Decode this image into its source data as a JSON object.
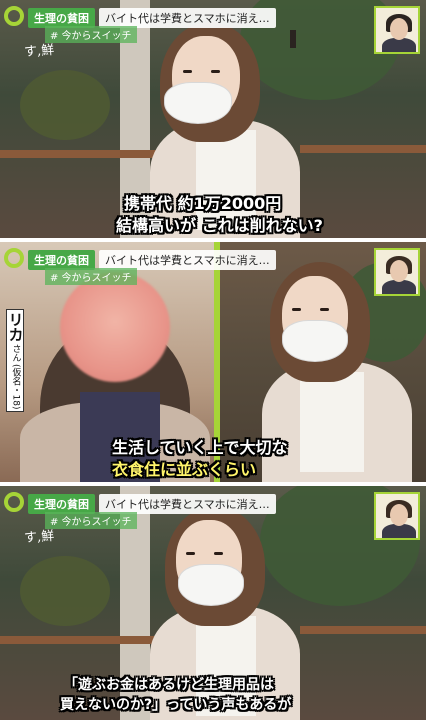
{
  "program": {
    "topic_badge": "生理の貧困",
    "headline": "バイト代は学費とスマホに消え…",
    "hashtag": "# 今からスイッチ",
    "sign_text": "す,鮮"
  },
  "interviewee": {
    "name": "リカ",
    "honorific": "さん",
    "detail": "(仮名・18)"
  },
  "panels": [
    {
      "caption_lines": [
        "携帯代 約1万2000円",
        "結構高いが これは削れない?"
      ]
    },
    {
      "caption_lines": [
        "生活していく上で大切な",
        "衣食住に並ぶくらい"
      ]
    },
    {
      "caption_lines": [
        "「遊ぶお金はあるけど生理用品は",
        "買えないのか?」っていう声もあるが"
      ]
    }
  ],
  "colors": {
    "badge_green": "#47a847",
    "accent_lime": "#a6d437",
    "caption_white": "#ffffff",
    "caption_yellow": "#fff46a"
  }
}
